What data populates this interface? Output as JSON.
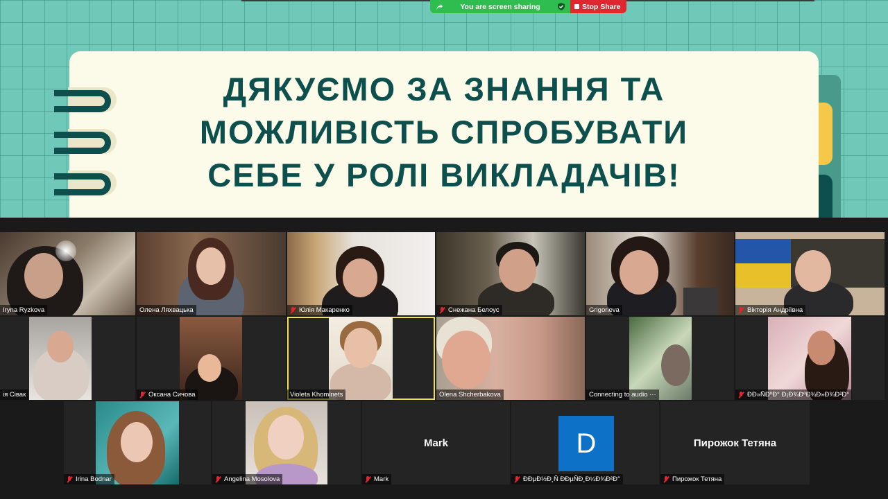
{
  "share_banner": {
    "status_text": "You are screen sharing",
    "stop_label": "Stop Share"
  },
  "slide": {
    "title_lines": [
      "ДЯКУЄМО ЗА ЗНАННЯ ТА",
      "МОЖЛИВІСТЬ СПРОБУВАТИ",
      "СЕБЕ У РОЛІ ВИКЛАДАЧІВ!"
    ],
    "colors": {
      "background": "#6fc8b8",
      "card": "#fcfbe9",
      "text": "#0d4f4c",
      "accent": "#f5c84a"
    }
  },
  "gallery": {
    "participants": [
      {
        "name": "Iryna Ryzkova",
        "muted": false
      },
      {
        "name": "Олена Ляхвацька",
        "muted": false
      },
      {
        "name": "Юлія Макаренко",
        "muted": true
      },
      {
        "name": "Снежана Белоус",
        "muted": true
      },
      {
        "name": "Grigorieva",
        "muted": false
      },
      {
        "name": "Вікторія Андріївна",
        "muted": true
      },
      {
        "name": "ія Сівак",
        "muted": false
      },
      {
        "name": "Оксана Сичова",
        "muted": true
      },
      {
        "name": "Violeta Khominets",
        "muted": false,
        "active_speaker": true
      },
      {
        "name": "Olena Shcherbakova",
        "muted": false
      },
      {
        "name": "Connecting to audio ···",
        "muted": false
      },
      {
        "name": "ÐÐ»ÑÐºÐ° Ð¡Ð¾ÐºÐ¾Ð»Ð¾Ð²Ð°",
        "muted": true
      },
      {
        "name": "Irina Bodnar",
        "muted": true
      },
      {
        "name": "Angelina Mosolova",
        "muted": true
      },
      {
        "name": "Mark",
        "muted": true,
        "video_off": true,
        "center_label": "Mark"
      },
      {
        "name": "ÐÐµÐ½Ð¸Ñ ÐÐµÑÐ¸Ð¼Ð¾Ð²Ð°",
        "muted": true,
        "video_off": true,
        "avatar_letter": "D"
      },
      {
        "name": "Пирожок Тетяна",
        "muted": true,
        "video_off": true,
        "center_label": "Пирожок Тетяна"
      }
    ]
  },
  "colors": {
    "share_green": "#2ebd4e",
    "stop_red": "#e0272f",
    "avatar_blue": "#0e71c8",
    "active_yellow": "#f2e24a"
  }
}
